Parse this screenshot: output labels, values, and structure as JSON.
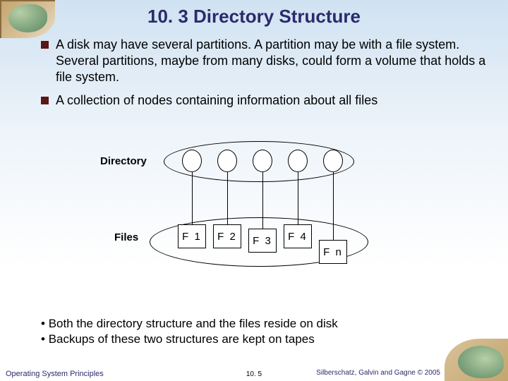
{
  "title": "10. 3 Directory Structure",
  "bullets": [
    "A disk may have several partitions. A partition may be with a file system. Several partitions, maybe from many disks, could form a volume that holds a file system.",
    "A collection of nodes containing information about all files"
  ],
  "diagram": {
    "dir_label": "Directory",
    "files_label": "Files",
    "files": [
      "F 1",
      "F 2",
      "F 3",
      "F 4",
      "F n"
    ]
  },
  "sub_bullets": [
    "Both the directory structure and the files reside on disk",
    "Backups of these two structures are kept on tapes"
  ],
  "footer": {
    "left": "Operating System Principles",
    "center": "10. 5",
    "right": "Silberschatz, Galvin and Gagne © 2005"
  }
}
